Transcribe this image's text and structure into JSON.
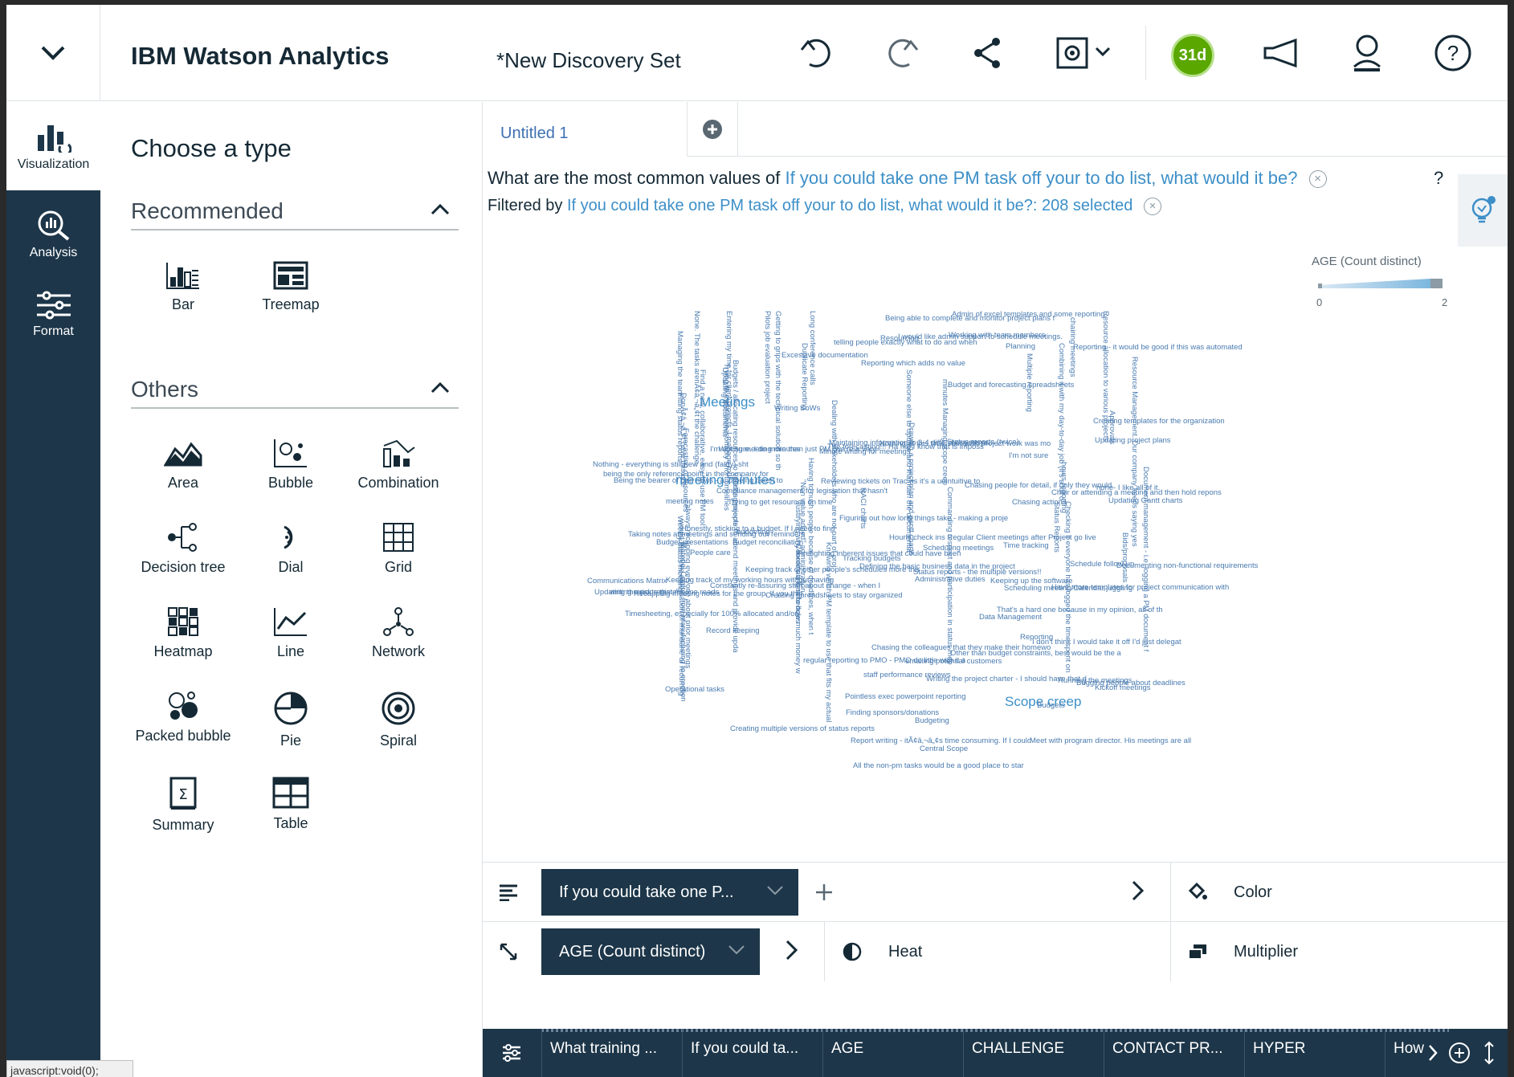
{
  "header": {
    "app_title": "IBM Watson Analytics",
    "set_title": "*New Discovery Set",
    "trial_days": "31d",
    "icons": [
      "chevron-down-icon",
      "undo-icon",
      "redo-icon",
      "share-icon",
      "screenshot-icon",
      "megaphone-icon",
      "user-icon",
      "help-icon"
    ]
  },
  "rail": {
    "items": [
      {
        "label": "Visualization",
        "icon": "visualization-icon"
      },
      {
        "label": "Analysis",
        "icon": "analysis-icon"
      },
      {
        "label": "Format",
        "icon": "format-sliders-icon"
      }
    ]
  },
  "type_panel": {
    "title": "Choose a type",
    "recommended_label": "Recommended",
    "recommended": [
      {
        "label": "Bar",
        "icon": "bar-chart-icon"
      },
      {
        "label": "Treemap",
        "icon": "treemap-icon"
      }
    ],
    "others_label": "Others",
    "others": [
      {
        "label": "Area",
        "icon": "area-icon"
      },
      {
        "label": "Bubble",
        "icon": "bubble-icon"
      },
      {
        "label": "Combination",
        "icon": "combination-icon"
      },
      {
        "label": "Decision tree",
        "icon": "decision-tree-icon"
      },
      {
        "label": "Dial",
        "icon": "dial-icon"
      },
      {
        "label": "Grid",
        "icon": "grid-icon"
      },
      {
        "label": "Heatmap",
        "icon": "heatmap-icon"
      },
      {
        "label": "Line",
        "icon": "line-icon"
      },
      {
        "label": "Network",
        "icon": "network-icon"
      },
      {
        "label": "Packed bubble",
        "icon": "packed-bubble-icon"
      },
      {
        "label": "Pie",
        "icon": "pie-icon"
      },
      {
        "label": "Spiral",
        "icon": "spiral-icon"
      },
      {
        "label": "Summary",
        "icon": "summary-icon"
      },
      {
        "label": "Table",
        "icon": "table-icon"
      }
    ]
  },
  "main": {
    "tab_label": "Untitled 1",
    "question_prefix": "What are the most common values of",
    "question_field": "If you could take one PM task off your to do list, what would it be?",
    "help_mark": "?",
    "filter_prefix": "Filtered by",
    "filter_value": "If you could take one PM task off your to do list, what would it be?: 208 selected",
    "legend": {
      "title": "AGE (Count distinct)",
      "min": "0",
      "max": "2"
    }
  },
  "wordcloud": {
    "big_words": [
      "Meetings",
      "meeting minutes",
      "Scope creep"
    ],
    "small_words": [
      "Budget presentations",
      "That's a hard one because in my opinion, all of th",
      "Weekly status meeting",
      "Writing meeting minutes",
      "Dealing with stakeholders who are not part of proj",
      "budgeting",
      "The forecasting!!! Ha ha! I know that is imposs",
      "DonÃ¢â‚¬â„¢t have this one",
      "Administrative duties",
      "I don't think I would take it off I'd just delegat",
      "Chasing actions",
      "Material Control from manufacturing to erection",
      "Duplicate Reporting",
      "Meet with program director. His meetings are all",
      "Keeping track of other people's schedules more tha",
      "Compliance management for legislation that hasn't",
      "Budgets",
      "Getting people to attend meetings and provide upda",
      "Trying to meet unreasonably short timelines",
      "I would like admin support to schedule meetings.",
      "Data Management",
      "Firefighting inherent issues that could have been",
      "Checking if everyone has logged the time spent on",
      "Excessive documentation",
      "Chair or attending a meeting and then hold repons",
      "would like more automation of mundane or recurring",
      "Timesheeting, especially for 100% allocated and/or",
      "always recapping everyone about prior meetings",
      "Chasing the colleagues that they make their homewo",
      "Nothing at this time...but wish project work was mo",
      "Report writing - itÃ¢â‚¬â„¢s time consuming. If I could",
      "Reporting - it would be good if this was automated",
      "Resource Management. Our company keeps saying yes",
      "Resourcing",
      "Figuring out how long things take - making a proje",
      "regular reporting to PMO - PMO do little with it a",
      "Writing the project charter - I should have that d",
      "Getting to grips with the technical solution so th",
      "All the non-pm tasks would be a good place to star",
      "hours reporting",
      "I'm not sure. I do more than just PM (we're a very",
      "writing reports that no one reads",
      "Find a new, collaborative, easy-to-use PM tool",
      "Bugging people about deadlines",
      "I'm not sure",
      "Time tracking",
      "Long conference calls",
      "Entering my time for client projects. I manage mul",
      "Central Scope",
      "Status reports - the multiple versions!!",
      "Scheduling meetings",
      "Being the bearer of bad news - and being taken to",
      "minutes Managing scope creep",
      "Having to nush people because of deadlines, when t",
      "Pointless exec powerpoint reporting",
      "Have more templates for project communication with",
      "emailing potential customers",
      "Someone else to update and maintain the documental",
      "Hourly check ins Regular Client meetings after Project go live",
      "Reviewing tickets on Trac as it's a unintuitive to",
      "Justifying why there's a limit to how much money w",
      "People care",
      "Document management - i.e. logging a PM document f",
      "Recapping meeting notes for the group. If you thin",
      "Creating multiple versions of status reports",
      "telling people exactly what to do and when",
      "staff performance reviews",
      "Commanding respect and participation in status mee",
      "Other than budget constraints, best would be the a",
      "Documenting non-functional requirements",
      "Constantly re-assuring staff about change - when I",
      "being the only reference point in the company for",
      "Forecasting of resources",
      "Kickoff meetings",
      "Pilots job evaluation project",
      "Creating templates for the organization",
      "Updating the risk register",
      "Multiple reporting",
      "Taking notes at meetings and sending out reminders",
      "Admin of excel templates and some reporting",
      "Nothing - everything is still new and (fairly) sht",
      "None. The tasks arenÃ¢â‚¬â„¢t the challenge.",
      "\"Non value added\" administration",
      "Updating Gantt charts",
      "Writing SoWs",
      "Being able to complete and monitor project plans f",
      "Honestly, sticking to a budget. If I need to find",
      "chairing meetings",
      "Status Reports",
      "Communications Matrix",
      "Minute writing for meetings",
      "Maintaining information in 3-4 different systems.",
      "RACI charts",
      "none- I like all of it.",
      "Schedule follow-up",
      "Updating documents",
      "Status reports (twice)",
      "Combining it with my day-to-day job (it's a lot o",
      "Keeping up the software",
      "Budget reconciliation",
      "Record keeping",
      "Defining the basic business data in the project",
      "Bids/proposals",
      "Keeping track of my working hours without having",
      "Chasing people for detail, if only they would",
      "Creating spreadsheets to stay organized",
      "Tracking budgets",
      "Drawing a project plan and gantt charts",
      "Trying to get resources on time",
      "Coordinating schedules",
      "Reporting which adds no value",
      "Budgeting",
      "Resource allocation to various projects",
      "Operational tasks",
      "Budget and forecasting spreadsheets",
      "Scheduling meeting/Calendar juggling",
      "Managing the team",
      "Knowing which PM template to use that fits my actual",
      "Updating project plans",
      "Working with team members",
      "Finding sponsors/donations",
      "Running the meetings",
      "Approvals",
      "Fitting status reports",
      "Reporting",
      "Planning",
      "meeting notes",
      "Budgets / allocating resources to various projects"
    ]
  },
  "config": {
    "rows_pill": "If you could take one P...",
    "size_pill": "AGE (Count distinct)",
    "color_label": "Color",
    "heat_label": "Heat",
    "multiplier_label": "Multiplier"
  },
  "columns": [
    "What training ...",
    "If you could ta...",
    "AGE",
    "CHALLENGE",
    "CONTACT PR...",
    "HYPER",
    "How"
  ],
  "status_bar": "javascript:void(0);",
  "colors": {
    "navy": "#1d3649",
    "link": "#3c8fc8",
    "trial_green": "#5aa700"
  }
}
